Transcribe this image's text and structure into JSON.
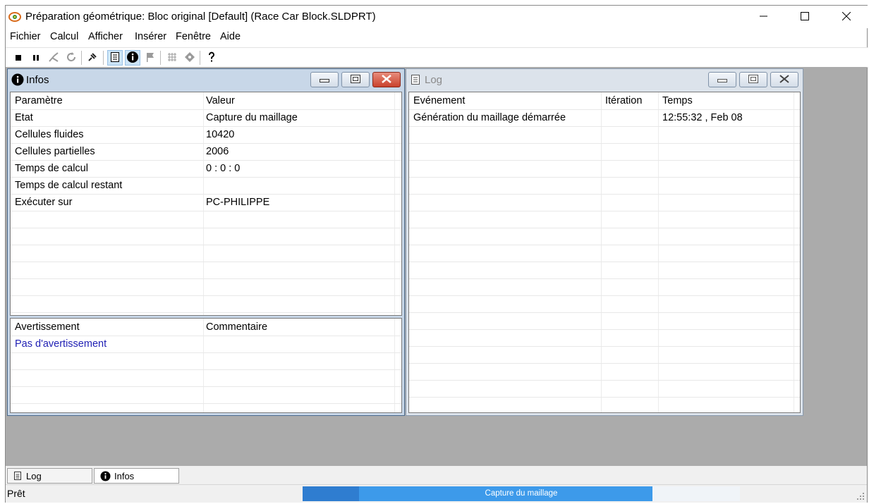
{
  "window": {
    "title": "Préparation géométrique: Bloc original [Default] (Race Car Block.SLDPRT)",
    "controls": {
      "minimize": "minimize-icon",
      "maximize": "maximize-icon",
      "close": "close-icon"
    }
  },
  "menu": [
    "Fichier",
    "Calcul",
    "Afficher",
    "Insérer",
    "Fenêtre",
    "Aide"
  ],
  "toolbar": {
    "icons": [
      "stop-icon",
      "pause-icon",
      "cut-icon",
      "refresh-icon",
      "pin-icon",
      "log-document-icon",
      "info-icon",
      "flag-icon",
      "grid-icon",
      "target-icon",
      "help-icon"
    ]
  },
  "infos": {
    "title": "Infos",
    "columns": [
      "Paramètre",
      "Valeur"
    ],
    "rows": [
      [
        "Etat",
        "Capture du maillage"
      ],
      [
        "Cellules fluides",
        "10420"
      ],
      [
        "Cellules partielles",
        "2006"
      ],
      [
        "Temps de calcul",
        "0 : 0 : 0"
      ],
      [
        "Temps de calcul restant",
        ""
      ],
      [
        "Exécuter sur",
        "PC-PHILIPPE"
      ]
    ],
    "warn_columns": [
      "Avertissement",
      "Commentaire"
    ],
    "warnings": [
      [
        "Pas d'avertissement",
        ""
      ]
    ],
    "warning_color": "#1f1fb4"
  },
  "log": {
    "title": "Log",
    "columns": [
      "Evénement",
      "Itération",
      "Temps"
    ],
    "rows": [
      [
        "Génération du maillage démarrée",
        "",
        "12:55:32 , Feb 08"
      ]
    ]
  },
  "tabs": [
    "Log",
    "Infos"
  ],
  "status": {
    "text": "Prêt",
    "progress_label": "Capture du maillage",
    "progress": 0.8
  },
  "colors": {
    "mdi_background": "#ababab",
    "active_title": "#c8d7e8",
    "inactive_title": "#dce3eb",
    "progress": "#3d9aea"
  }
}
